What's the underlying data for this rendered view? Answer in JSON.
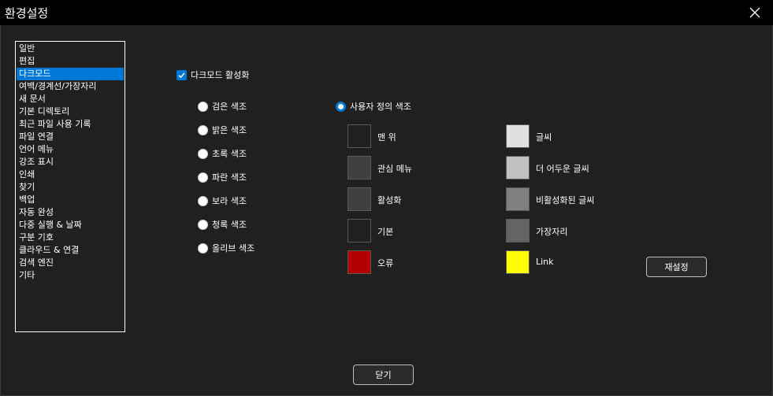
{
  "window": {
    "title": "환경설정"
  },
  "sidebar": {
    "items": [
      {
        "label": "일반",
        "selected": false
      },
      {
        "label": "편집",
        "selected": false
      },
      {
        "label": "다크모드",
        "selected": true
      },
      {
        "label": "여백/경계선/가장자리",
        "selected": false
      },
      {
        "label": "새 문서",
        "selected": false
      },
      {
        "label": "기본 디렉토리",
        "selected": false
      },
      {
        "label": "최근 파일 사용 기록",
        "selected": false
      },
      {
        "label": "파일 연결",
        "selected": false
      },
      {
        "label": "언어 메뉴",
        "selected": false
      },
      {
        "label": "강조 표시",
        "selected": false
      },
      {
        "label": "인쇄",
        "selected": false
      },
      {
        "label": "찾기",
        "selected": false
      },
      {
        "label": "백업",
        "selected": false
      },
      {
        "label": "자동 완성",
        "selected": false
      },
      {
        "label": "다중 실행 & 날짜",
        "selected": false
      },
      {
        "label": "구분 기호",
        "selected": false
      },
      {
        "label": "클라우드 & 연결",
        "selected": false
      },
      {
        "label": "검색 엔진",
        "selected": false
      },
      {
        "label": "기타",
        "selected": false
      }
    ]
  },
  "darkmode": {
    "enable_label": "다크모드 활성화",
    "enabled": true,
    "themes": [
      {
        "label": "검은 색조",
        "checked": false
      },
      {
        "label": "밝은 색조",
        "checked": false
      },
      {
        "label": "초록 색조",
        "checked": false
      },
      {
        "label": "파란 색조",
        "checked": false
      },
      {
        "label": "보라 색조",
        "checked": false
      },
      {
        "label": "청록 색조",
        "checked": false
      },
      {
        "label": "올리브 색조",
        "checked": false
      }
    ],
    "custom": {
      "label": "사용자 정의 색조",
      "checked": true
    },
    "colors_left": [
      {
        "label": "맨 위",
        "color": "#202020"
      },
      {
        "label": "관심 메뉴",
        "color": "#404040"
      },
      {
        "label": "활성화",
        "color": "#404040"
      },
      {
        "label": "기본",
        "color": "#202020"
      },
      {
        "label": "오류",
        "color": "#b00000"
      }
    ],
    "colors_right": [
      {
        "label": "글씨",
        "color": "#e0e0e0"
      },
      {
        "label": "더 어두운 글씨",
        "color": "#c0c0c0"
      },
      {
        "label": "비활성화된 글씨",
        "color": "#808080"
      },
      {
        "label": "가장자리",
        "color": "#646464"
      },
      {
        "label": "Link",
        "color": "#ffff00"
      }
    ],
    "reset_label": "재설정"
  },
  "footer": {
    "close_label": "닫기"
  },
  "icons": {
    "close": "close-icon",
    "check": "checkmark-icon"
  },
  "accent": "#0078d7"
}
